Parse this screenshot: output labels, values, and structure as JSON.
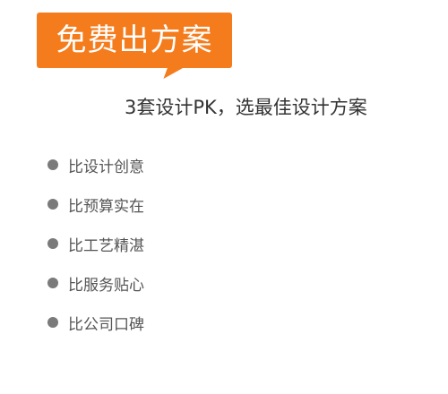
{
  "badge": {
    "label": "免费出方案",
    "color": "#f47c1c"
  },
  "headline": "3套设计PK，选最佳设计方案",
  "features": [
    {
      "label": "比设计创意",
      "icon": "bullet-dot-icon"
    },
    {
      "label": "比预算实在",
      "icon": "bullet-dot-icon"
    },
    {
      "label": "比工艺精湛",
      "icon": "bullet-dot-icon"
    },
    {
      "label": "比服务贴心",
      "icon": "bullet-dot-icon"
    },
    {
      "label": "比公司口碑",
      "icon": "bullet-dot-icon"
    }
  ]
}
